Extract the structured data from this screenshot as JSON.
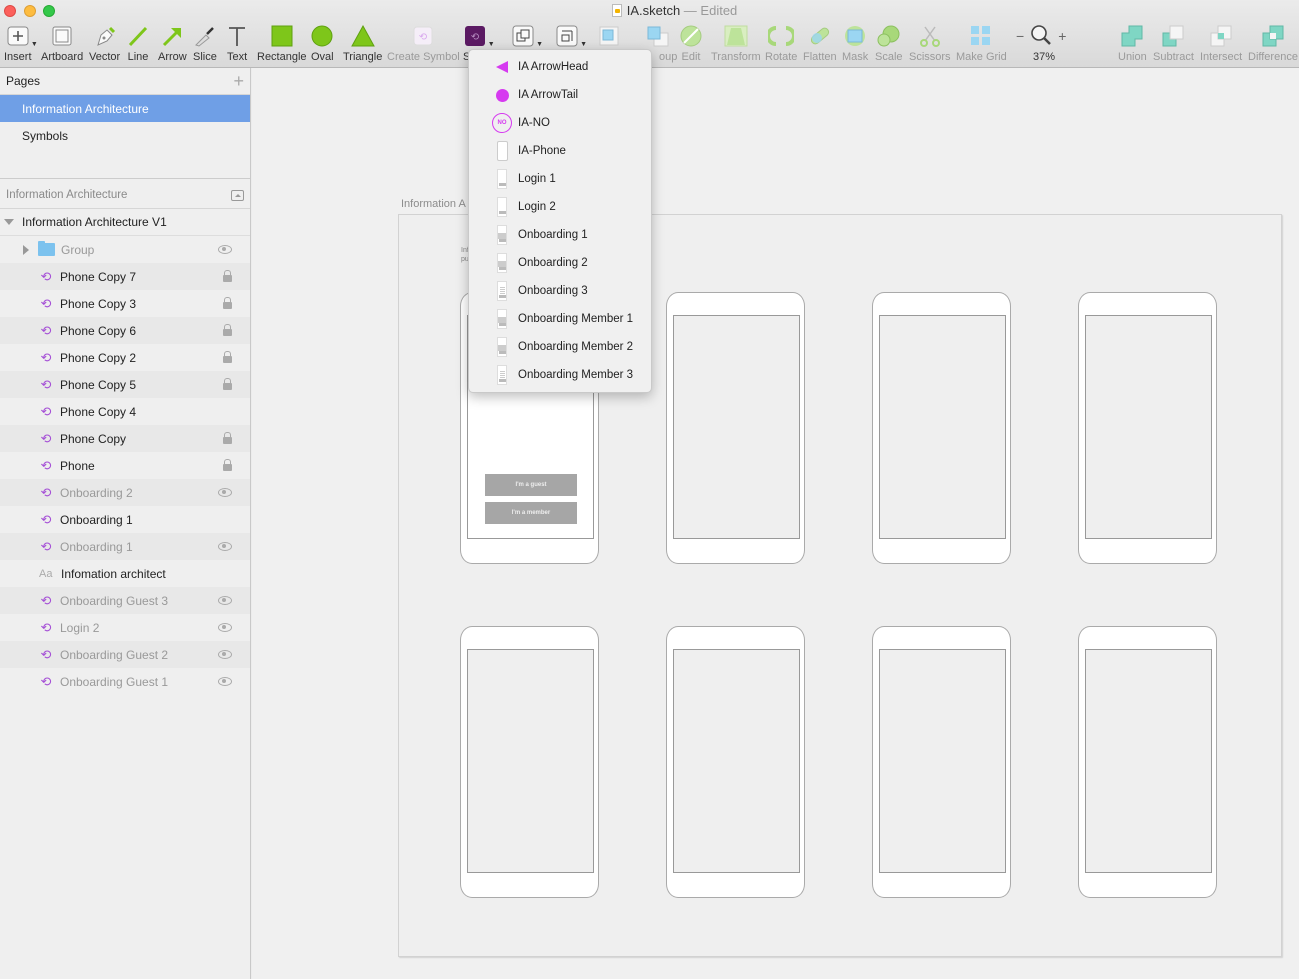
{
  "window": {
    "document_name": "IA.sketch",
    "separator": "—",
    "status": "Edited"
  },
  "toolbar": {
    "insert": "Insert",
    "artboard": "Artboard",
    "vector": "Vector",
    "line": "Line",
    "arrow": "Arrow",
    "slice": "Slice",
    "text": "Text",
    "rectangle": "Rectangle",
    "oval": "Oval",
    "triangle": "Triangle",
    "create_symbol": "Create Symbol",
    "symbols_partial": "S",
    "group_partial": "oup",
    "edit": "Edit",
    "transform": "Transform",
    "rotate": "Rotate",
    "flatten": "Flatten",
    "mask": "Mask",
    "scale": "Scale",
    "scissors": "Scissors",
    "make_grid": "Make Grid",
    "zoom_minus": "−",
    "zoom_plus": "+",
    "zoom_level": "37%",
    "union": "Union",
    "subtract": "Subtract",
    "intersect": "Intersect",
    "difference": "Difference",
    "colors": {
      "shape_green": "#7ec61a",
      "symbol_purple": "#5b1a63",
      "boolean_teal": "#7fd6c4"
    }
  },
  "pages": {
    "title": "Pages",
    "add_icon": "+",
    "items": [
      {
        "label": "Information Architecture",
        "selected": true
      },
      {
        "label": "Symbols",
        "selected": false
      }
    ]
  },
  "layers": {
    "header": "Information Architecture",
    "artboard_name": "Information Architecture V1",
    "items": [
      {
        "type": "group",
        "label": "Group",
        "hidden": true,
        "indicator": "eye"
      },
      {
        "type": "symbol",
        "label": "Phone Copy 7",
        "hidden": false,
        "indicator": "lock"
      },
      {
        "type": "symbol",
        "label": "Phone Copy 3",
        "hidden": false,
        "indicator": "lock"
      },
      {
        "type": "symbol",
        "label": "Phone Copy 6",
        "hidden": false,
        "indicator": "lock"
      },
      {
        "type": "symbol",
        "label": "Phone Copy 2",
        "hidden": false,
        "indicator": "lock"
      },
      {
        "type": "symbol",
        "label": "Phone Copy 5",
        "hidden": false,
        "indicator": "lock"
      },
      {
        "type": "symbol",
        "label": "Phone Copy 4",
        "hidden": false,
        "indicator": ""
      },
      {
        "type": "symbol",
        "label": "Phone Copy",
        "hidden": false,
        "indicator": "lock"
      },
      {
        "type": "symbol",
        "label": "Phone",
        "hidden": false,
        "indicator": "lock"
      },
      {
        "type": "symbol",
        "label": "Onboarding 2",
        "hidden": true,
        "indicator": "eye"
      },
      {
        "type": "symbol",
        "label": "Onboarding 1",
        "hidden": false,
        "indicator": ""
      },
      {
        "type": "symbol",
        "label": "Onboarding 1",
        "hidden": true,
        "indicator": "eye"
      },
      {
        "type": "text",
        "label": "Infomation architect",
        "hidden": false,
        "indicator": ""
      },
      {
        "type": "symbol",
        "label": "Onboarding Guest 3",
        "hidden": true,
        "indicator": "eye"
      },
      {
        "type": "symbol",
        "label": "Login 2",
        "hidden": true,
        "indicator": "eye"
      },
      {
        "type": "symbol",
        "label": "Onboarding Guest 2",
        "hidden": true,
        "indicator": "eye"
      },
      {
        "type": "symbol",
        "label": "Onboarding Guest 1",
        "hidden": true,
        "indicator": "eye"
      }
    ],
    "text_icon": "Aa",
    "symbol_icon": "⟲"
  },
  "canvas": {
    "artboard_label": "Information A",
    "artboard_text_line1": "Inf",
    "artboard_text_line2": "pu",
    "guest_button": "I'm a guest",
    "member_button": "I'm a member"
  },
  "symbol_menu": {
    "items": [
      {
        "label": "IA ArrowHead",
        "icon": "arrowhead"
      },
      {
        "label": "IA ArrowTail",
        "icon": "arrowtail"
      },
      {
        "label": "IA-NO",
        "icon": "no"
      },
      {
        "label": "IA-Phone",
        "icon": "phone"
      },
      {
        "label": "Login 1",
        "icon": "thumb"
      },
      {
        "label": "Login 2",
        "icon": "thumb"
      },
      {
        "label": "Onboarding 1",
        "icon": "thumb-gray"
      },
      {
        "label": "Onboarding 2",
        "icon": "thumb-gray"
      },
      {
        "label": "Onboarding 3",
        "icon": "thumb-lines"
      },
      {
        "label": "Onboarding Member 1",
        "icon": "thumb-gray"
      },
      {
        "label": "Onboarding Member 2",
        "icon": "thumb-gray"
      },
      {
        "label": "Onboarding Member 3",
        "icon": "thumb-lines"
      }
    ],
    "no_icon_text": "NO",
    "accent": "#d63af0"
  }
}
